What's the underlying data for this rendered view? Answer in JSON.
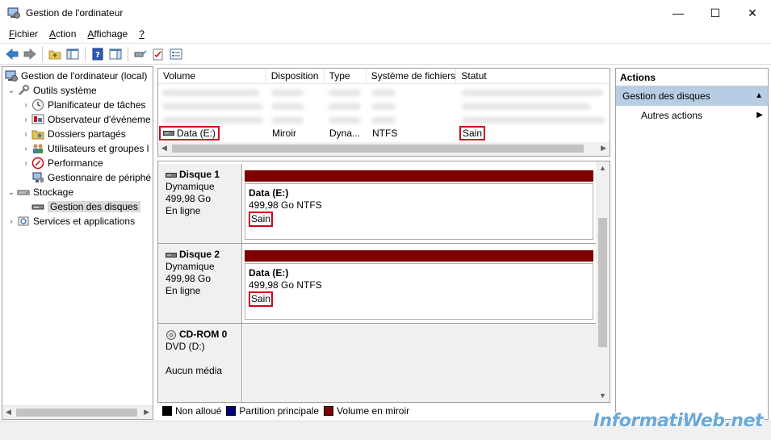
{
  "window": {
    "title": "Gestion de l'ordinateur",
    "minimize": "—",
    "maximize": "☐",
    "close": "✕"
  },
  "menu": {
    "items": [
      {
        "label": "Fichier",
        "accel": "F",
        "rest": "ichier"
      },
      {
        "label": "Action",
        "accel": "A",
        "rest": "ction"
      },
      {
        "label": "Affichage",
        "accel": "A",
        "rest": "ffichage"
      },
      {
        "label": "?",
        "accel": "?",
        "rest": ""
      }
    ]
  },
  "tree": {
    "root": "Gestion de l'ordinateur (local)",
    "items": [
      {
        "label": "Outils système",
        "icon": "tools-icon"
      },
      {
        "label": "Planificateur de tâches",
        "icon": "clock-icon"
      },
      {
        "label": "Observateur d'événeme",
        "icon": "event-viewer-icon"
      },
      {
        "label": "Dossiers partagés",
        "icon": "shared-folder-icon"
      },
      {
        "label": "Utilisateurs et groupes l",
        "icon": "users-icon"
      },
      {
        "label": "Performance",
        "icon": "performance-icon"
      },
      {
        "label": "Gestionnaire de périphé",
        "icon": "device-manager-icon"
      },
      {
        "label": "Stockage",
        "icon": "storage-icon"
      },
      {
        "label": "Gestion des disques",
        "icon": "disk-management-icon"
      },
      {
        "label": "Services et applications",
        "icon": "services-icon"
      }
    ]
  },
  "volumes": {
    "columns": [
      "Volume",
      "Disposition",
      "Type",
      "Système de fichiers",
      "Statut"
    ],
    "row": {
      "volume": "Data (E:)",
      "disposition": "Miroir",
      "type": "Dyna...",
      "fs": "NTFS",
      "status": "Sain"
    }
  },
  "disks": [
    {
      "name": "Disque 1",
      "kind": "Dynamique",
      "size": "499,98 Go",
      "state": "En ligne",
      "volume": {
        "name": "Data  (E:)",
        "detail": "499,98 Go NTFS",
        "status": "Sain"
      }
    },
    {
      "name": "Disque 2",
      "kind": "Dynamique",
      "size": "499,98 Go",
      "state": "En ligne",
      "volume": {
        "name": "Data  (E:)",
        "detail": "499,98 Go NTFS",
        "status": "Sain"
      }
    },
    {
      "name": "CD-ROM 0",
      "kind": "DVD (D:)",
      "media": "Aucun média"
    }
  ],
  "legend": [
    {
      "label": "Non alloué",
      "color": "#000000"
    },
    {
      "label": "Partition principale",
      "color": "#00007f"
    },
    {
      "label": "Volume en miroir",
      "color": "#7f0000"
    }
  ],
  "actions": {
    "header": "Actions",
    "section": "Gestion des disques",
    "item": "Autres actions"
  },
  "watermark": "InformatiWeb.net",
  "colors": {
    "mirror": "#7f0000",
    "highlight": "#d0021b",
    "action_section": "#b7cde3"
  }
}
